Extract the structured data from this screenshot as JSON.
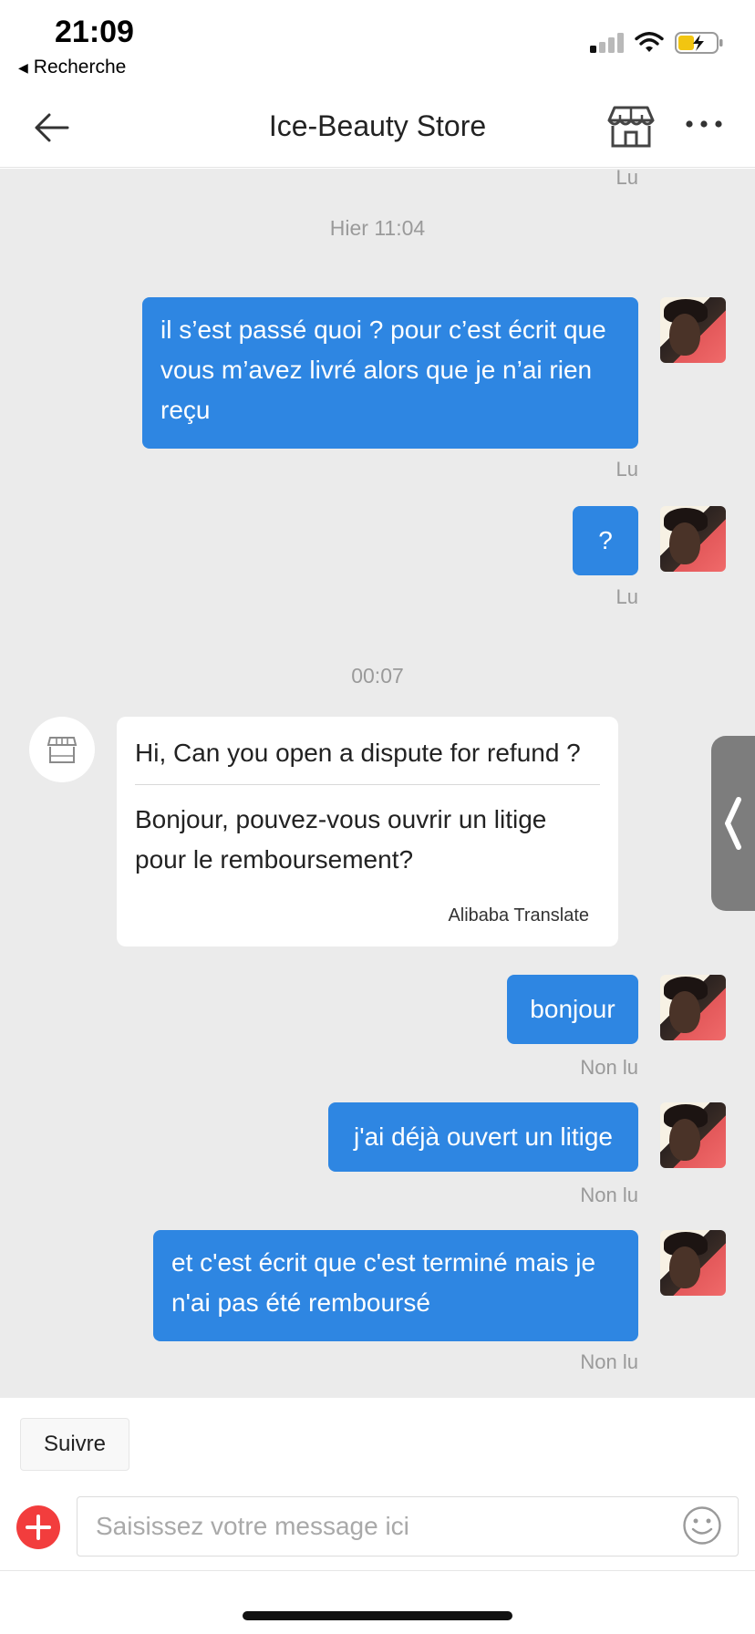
{
  "status_bar": {
    "time": "21:09",
    "back_label": "Recherche"
  },
  "header": {
    "title": "Ice-Beauty Store"
  },
  "icons": {
    "back": "arrow-left-icon",
    "store": "store-icon",
    "more": "more-icon",
    "side_tab": "chevron-left-icon",
    "plus": "plus-icon",
    "emoji": "emoji-icon"
  },
  "chat": {
    "top_status": "Lu",
    "timestamp_1": "Hier 11:04",
    "msg1": {
      "line1": "il s’est passé quoi ? pour c’est écrit que",
      "line2": "vous m’avez livré alors que je n’ai rien",
      "line3": "reçu",
      "status": "Lu"
    },
    "msg2": {
      "text": "?",
      "status": "Lu"
    },
    "timestamp_2": "00:07",
    "incoming": {
      "original": "Hi, Can you open a dispute for refund ?",
      "translated_line1": "Bonjour, pouvez-vous ouvrir un litige",
      "translated_line2": "pour le remboursement?",
      "translator": "Alibaba Translate"
    },
    "msg3": {
      "text": "bonjour",
      "status": "Non lu"
    },
    "msg4": {
      "text": "j'ai déjà ouvert un litige",
      "status": "Non lu"
    },
    "msg5": {
      "line1": "et c'est écrit que c'est terminé mais je",
      "line2": "n'ai pas été remboursé",
      "status": "Non lu"
    }
  },
  "bottom": {
    "follow_label": "Suivre",
    "input_placeholder": "Saisissez votre message ici"
  },
  "colors": {
    "bubble_out": "#2e86e2",
    "chat_bg": "#ebebeb",
    "plus_button": "#f23d3d"
  }
}
